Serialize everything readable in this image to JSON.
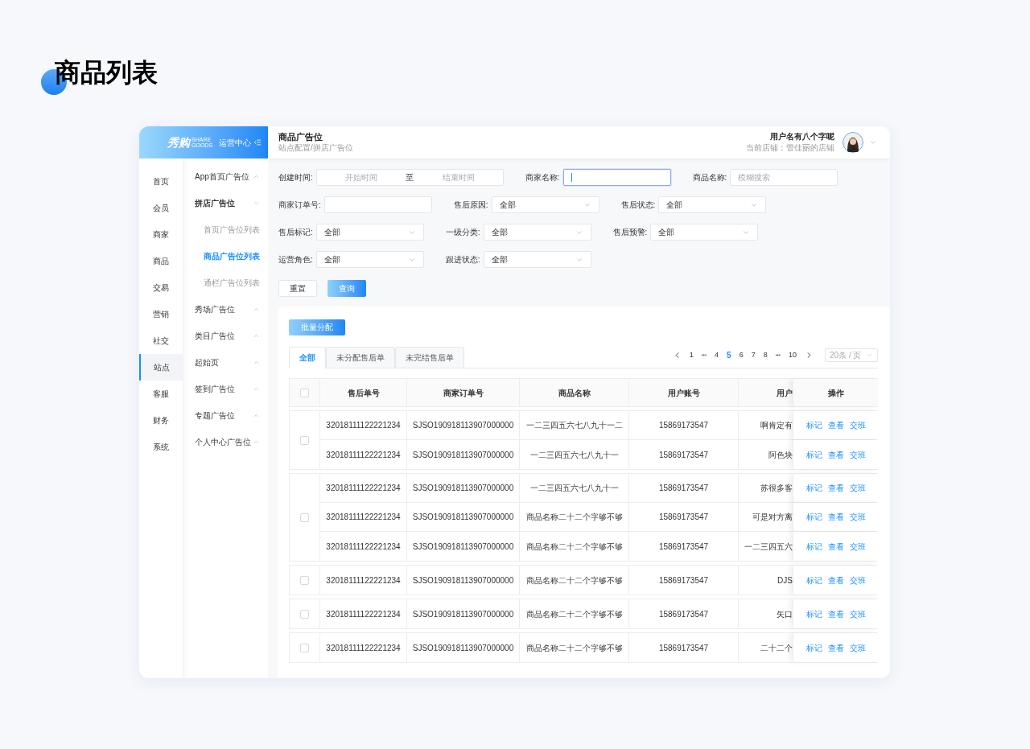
{
  "page_title": "商品列表",
  "sidebar": {
    "logo": {
      "brand": "秀购",
      "brand_en_top": "SHARE",
      "brand_en_bottom": "GOODS",
      "subtitle": "运营中心"
    },
    "nav": [
      {
        "label": "首页",
        "selected": false
      },
      {
        "label": "会员",
        "selected": false
      },
      {
        "label": "商家",
        "selected": false
      },
      {
        "label": "商品",
        "selected": false
      },
      {
        "label": "交易",
        "selected": false
      },
      {
        "label": "营销",
        "selected": false
      },
      {
        "label": "社交",
        "selected": false
      },
      {
        "label": "站点",
        "selected": true
      },
      {
        "label": "客服",
        "selected": false
      },
      {
        "label": "财务",
        "selected": false
      },
      {
        "label": "系统",
        "selected": false
      }
    ],
    "submenu": [
      {
        "label": "App首页广告位",
        "expanded": false
      },
      {
        "label": "拼店广告位",
        "expanded": true,
        "children": [
          {
            "label": "首页广告位列表",
            "selected": false
          },
          {
            "label": "商品广告位列表",
            "selected": true
          },
          {
            "label": "通栏广告位列表",
            "selected": false
          }
        ]
      },
      {
        "label": "秀场广告位",
        "expanded": false
      },
      {
        "label": "类目广告位",
        "expanded": false
      },
      {
        "label": "起始页",
        "expanded": false
      },
      {
        "label": "签到广告位",
        "expanded": false
      },
      {
        "label": "专题广告位",
        "expanded": false
      },
      {
        "label": "个人中心广告位",
        "expanded": false
      }
    ]
  },
  "header": {
    "title": "商品广告位",
    "breadcrumb": "站点配置/拼店广告位",
    "user_name": "用户名有八个字呢",
    "store": "当前店铺：管佳丽的店铺"
  },
  "filters": [
    [
      {
        "kind": "daterange",
        "label": "创建时间:",
        "start": "开始时间",
        "separator": "至",
        "end": "结束时间"
      },
      {
        "kind": "input",
        "label": "商家名称:",
        "focused": true
      },
      {
        "kind": "input",
        "label": "商品名称:",
        "placeholder": "模糊搜索",
        "focused": false
      }
    ],
    [
      {
        "kind": "input",
        "label": "商家订单号:",
        "focused": false
      },
      {
        "kind": "select",
        "label": "售后原因:",
        "value": "全部"
      },
      {
        "kind": "select",
        "label": "售后状态:",
        "value": "全部"
      }
    ],
    [
      {
        "kind": "select",
        "label": "售后标记:",
        "value": "全部"
      },
      {
        "kind": "select",
        "label": "一级分类:",
        "value": "全部"
      },
      {
        "kind": "select",
        "label": "售后预警:",
        "value": "全部"
      }
    ],
    [
      {
        "kind": "select",
        "label": "运营角色:",
        "value": "全部"
      },
      {
        "kind": "select",
        "label": "跟进状态:",
        "value": "全部"
      }
    ]
  ],
  "filter_buttons": [
    {
      "label": "重置",
      "kind": "default"
    },
    {
      "label": "查询",
      "kind": "primary"
    }
  ],
  "batch_button": "批量分配",
  "tabs": [
    {
      "label": "全部",
      "selected": true
    },
    {
      "label": "未分配售后单",
      "selected": false
    },
    {
      "label": "未完结售后单",
      "selected": false
    }
  ],
  "pagination": {
    "items": [
      {
        "kind": "prev"
      },
      {
        "kind": "page",
        "label": "1",
        "selected": false
      },
      {
        "kind": "ellipsis",
        "label": "•••"
      },
      {
        "kind": "page",
        "label": "4",
        "selected": false
      },
      {
        "kind": "page",
        "label": "5",
        "selected": true
      },
      {
        "kind": "page",
        "label": "6",
        "selected": false
      },
      {
        "kind": "page",
        "label": "7",
        "selected": false
      },
      {
        "kind": "page",
        "label": "8",
        "selected": false
      },
      {
        "kind": "ellipsis",
        "label": "•••"
      },
      {
        "kind": "page",
        "label": "10",
        "selected": false
      },
      {
        "kind": "next"
      }
    ],
    "page_size": "20条 / 页"
  },
  "table": {
    "header_checked": false,
    "columns": [
      "售后单号",
      "商家订单号",
      "商品名称",
      "用户账号",
      "用户"
    ],
    "actions_column": "操作",
    "groups": [
      {
        "checked": false,
        "rows": [
          {
            "after_sale_no": "32018111122221234",
            "order_no": "SJSO190918113907000000",
            "product": "一二三四五六七八九十一二",
            "account": "15869173547",
            "user": "啊肯定有",
            "actions": [
              "标记",
              "查看",
              "交班"
            ]
          },
          {
            "after_sale_no": "32018111122221234",
            "order_no": "SJSO190918113907000000",
            "product": "一二三四五六七八九十一",
            "account": "15869173547",
            "user": "阿色块",
            "actions": [
              "标记",
              "查看",
              "交班"
            ]
          }
        ]
      },
      {
        "checked": false,
        "rows": [
          {
            "after_sale_no": "32018111122221234",
            "order_no": "SJSO190918113907000000",
            "product": "一二三四五六七八九十一",
            "account": "15869173547",
            "user": "苏很多客",
            "actions": [
              "标记",
              "查看",
              "交班"
            ]
          },
          {
            "after_sale_no": "32018111122221234",
            "order_no": "SJSO190918113907000000",
            "product": "商品名称二十二个字够不够",
            "account": "15869173547",
            "user": "可是对方离",
            "actions": [
              "标记",
              "查看",
              "交班"
            ]
          },
          {
            "after_sale_no": "32018111122221234",
            "order_no": "SJSO190918113907000000",
            "product": "商品名称二十二个字够不够",
            "account": "15869173547",
            "user": "一二三四五六",
            "actions": [
              "标记",
              "查看",
              "交班"
            ]
          }
        ]
      },
      {
        "checked": false,
        "rows": [
          {
            "after_sale_no": "32018111122221234",
            "order_no": "SJSO190918113907000000",
            "product": "商品名称二十二个字够不够",
            "account": "15869173547",
            "user": "DJS",
            "actions": [
              "标记",
              "查看",
              "交班"
            ]
          }
        ]
      },
      {
        "checked": false,
        "rows": [
          {
            "after_sale_no": "32018111122221234",
            "order_no": "SJSO190918113907000000",
            "product": "商品名称二十二个字够不够",
            "account": "15869173547",
            "user": "矢口",
            "actions": [
              "标记",
              "查看",
              "交班"
            ]
          }
        ]
      },
      {
        "checked": false,
        "rows": [
          {
            "after_sale_no": "32018111122221234",
            "order_no": "SJSO190918113907000000",
            "product": "商品名称二十二个字够不够",
            "account": "15869173547",
            "user": "二十二个",
            "actions": [
              "标记",
              "查看",
              "交班"
            ]
          }
        ]
      }
    ]
  }
}
